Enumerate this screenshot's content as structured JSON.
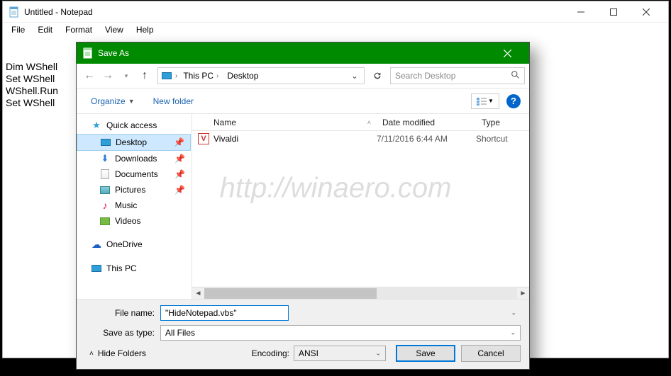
{
  "notepad": {
    "title": "Untitled - Notepad",
    "menus": {
      "file": "File",
      "edit": "Edit",
      "format": "Format",
      "view": "View",
      "help": "Help"
    },
    "code_lines": [
      "Dim WShell",
      "Set WShell",
      "WShell.Run",
      "Set WShell"
    ]
  },
  "dialog": {
    "title": "Save As",
    "path": {
      "root": "This PC",
      "folder": "Desktop"
    },
    "search_placeholder": "Search Desktop",
    "toolbar": {
      "organize": "Organize",
      "newfolder": "New folder"
    },
    "nav": {
      "quick": "Quick access",
      "items": [
        {
          "label": "Desktop",
          "pinned": true
        },
        {
          "label": "Downloads",
          "pinned": true
        },
        {
          "label": "Documents",
          "pinned": true
        },
        {
          "label": "Pictures",
          "pinned": true
        },
        {
          "label": "Music",
          "pinned": false
        },
        {
          "label": "Videos",
          "pinned": false
        }
      ],
      "onedrive": "OneDrive",
      "thispc": "This PC"
    },
    "columns": {
      "name": "Name",
      "date": "Date modified",
      "type": "Type"
    },
    "files": [
      {
        "name": "Vivaldi",
        "date": "7/11/2016 6:44 AM",
        "type": "Shortcut"
      }
    ],
    "filename_label": "File name:",
    "filename_value": "\"HideNotepad.vbs\"",
    "saveastype_label": "Save as type:",
    "saveastype_value": "All Files",
    "hidefolders": "Hide Folders",
    "encoding_label": "Encoding:",
    "encoding_value": "ANSI",
    "save": "Save",
    "cancel": "Cancel"
  },
  "watermark": "http://winaero.com"
}
